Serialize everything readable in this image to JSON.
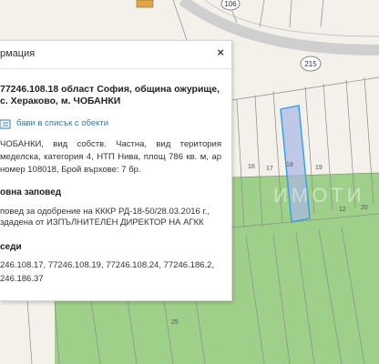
{
  "map": {
    "road_number_top": "106",
    "road_number_right": "215",
    "parcel_labels": [
      "16",
      "17",
      "18",
      "19",
      "20",
      "12",
      "25"
    ],
    "selected_parcel_label": "18",
    "watermark": "ИМОТИ",
    "colors": {
      "background": "#f4f1ea",
      "green_area": "#9fd08a",
      "selected_parcel_fill": "#a8b6e6",
      "selected_parcel_stroke": "#2f9fe8",
      "boundary": "#8a8a8a",
      "road": "#cfcfcf"
    }
  },
  "panel": {
    "title": "рмация",
    "close_icon": "×",
    "parcel_title": "77246.108.18 област София, община ожурище, с. Хераково, м. ЧОБАНКИ",
    "add_to_list": "бави в списък с обекти",
    "description": "ЧОБАНКИ, вид собств. Частна, вид територия меделска, категория 4, НТП Нива, площ 786 кв. м, ар номер 108018, Брой върхове: 7 бр.",
    "order_heading": "овна заповед",
    "order_text": "повед за одобрение на КККР РД-18-50/28.03.2016 г., здадена от ИЗПЪЛНИТЕЛЕН ДИРЕКТОР НА АГКК",
    "neighbors_heading": "седи",
    "neighbors_text": "246.108.17, 77246.108.19, 77246.108.24, 77246.186.2, 246.186.37"
  }
}
